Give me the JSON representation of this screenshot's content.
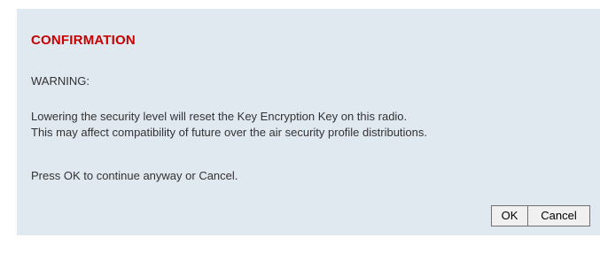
{
  "dialog": {
    "title": "CONFIRMATION",
    "warning": "WARNING:",
    "message_line1": "Lowering the security level will reset the Key Encryption Key on this radio.",
    "message_line2": "This may affect compatibility of future over the air security profile distributions.",
    "prompt": "Press OK to continue anyway or Cancel.",
    "ok_label": "OK",
    "cancel_label": "Cancel"
  },
  "colors": {
    "title": "#c80000",
    "dialog_background": "#e0e8f0",
    "text": "#333333"
  }
}
